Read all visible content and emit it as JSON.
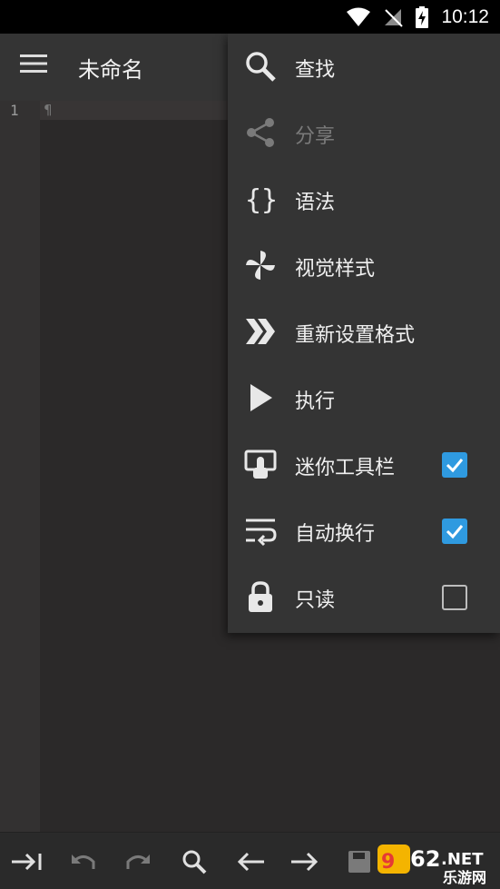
{
  "status_bar": {
    "time": "10:12"
  },
  "app_bar": {
    "title": "未命名"
  },
  "editor": {
    "line_number": "1",
    "pilcrow": "¶"
  },
  "overflow_menu": {
    "items": [
      {
        "label": "查找",
        "icon": "search-icon",
        "enabled": true
      },
      {
        "label": "分享",
        "icon": "share-icon",
        "enabled": false
      },
      {
        "label": "语法",
        "icon": "braces-icon",
        "enabled": true
      },
      {
        "label": "视觉样式",
        "icon": "pinwheel-icon",
        "enabled": true
      },
      {
        "label": "重新设置格式",
        "icon": "double-chevron-icon",
        "enabled": true
      },
      {
        "label": "执行",
        "icon": "play-icon",
        "enabled": true
      },
      {
        "label": "迷你工具栏",
        "icon": "touch-screen-icon",
        "enabled": true,
        "checked": true
      },
      {
        "label": "自动换行",
        "icon": "wrap-text-icon",
        "enabled": true,
        "checked": true
      },
      {
        "label": "只读",
        "icon": "lock-icon",
        "enabled": true,
        "checked": false
      }
    ]
  },
  "bottom_toolbar": {
    "buttons": [
      "tab-icon",
      "undo-icon",
      "redo-icon",
      "search-icon",
      "arrow-left-icon",
      "arrow-right-icon",
      "save-icon"
    ]
  },
  "watermark": {
    "text": "乐游网"
  },
  "colors": {
    "accent": "#2f9ae0",
    "menu_bg": "#343434",
    "editor_bg": "#2b2929"
  }
}
